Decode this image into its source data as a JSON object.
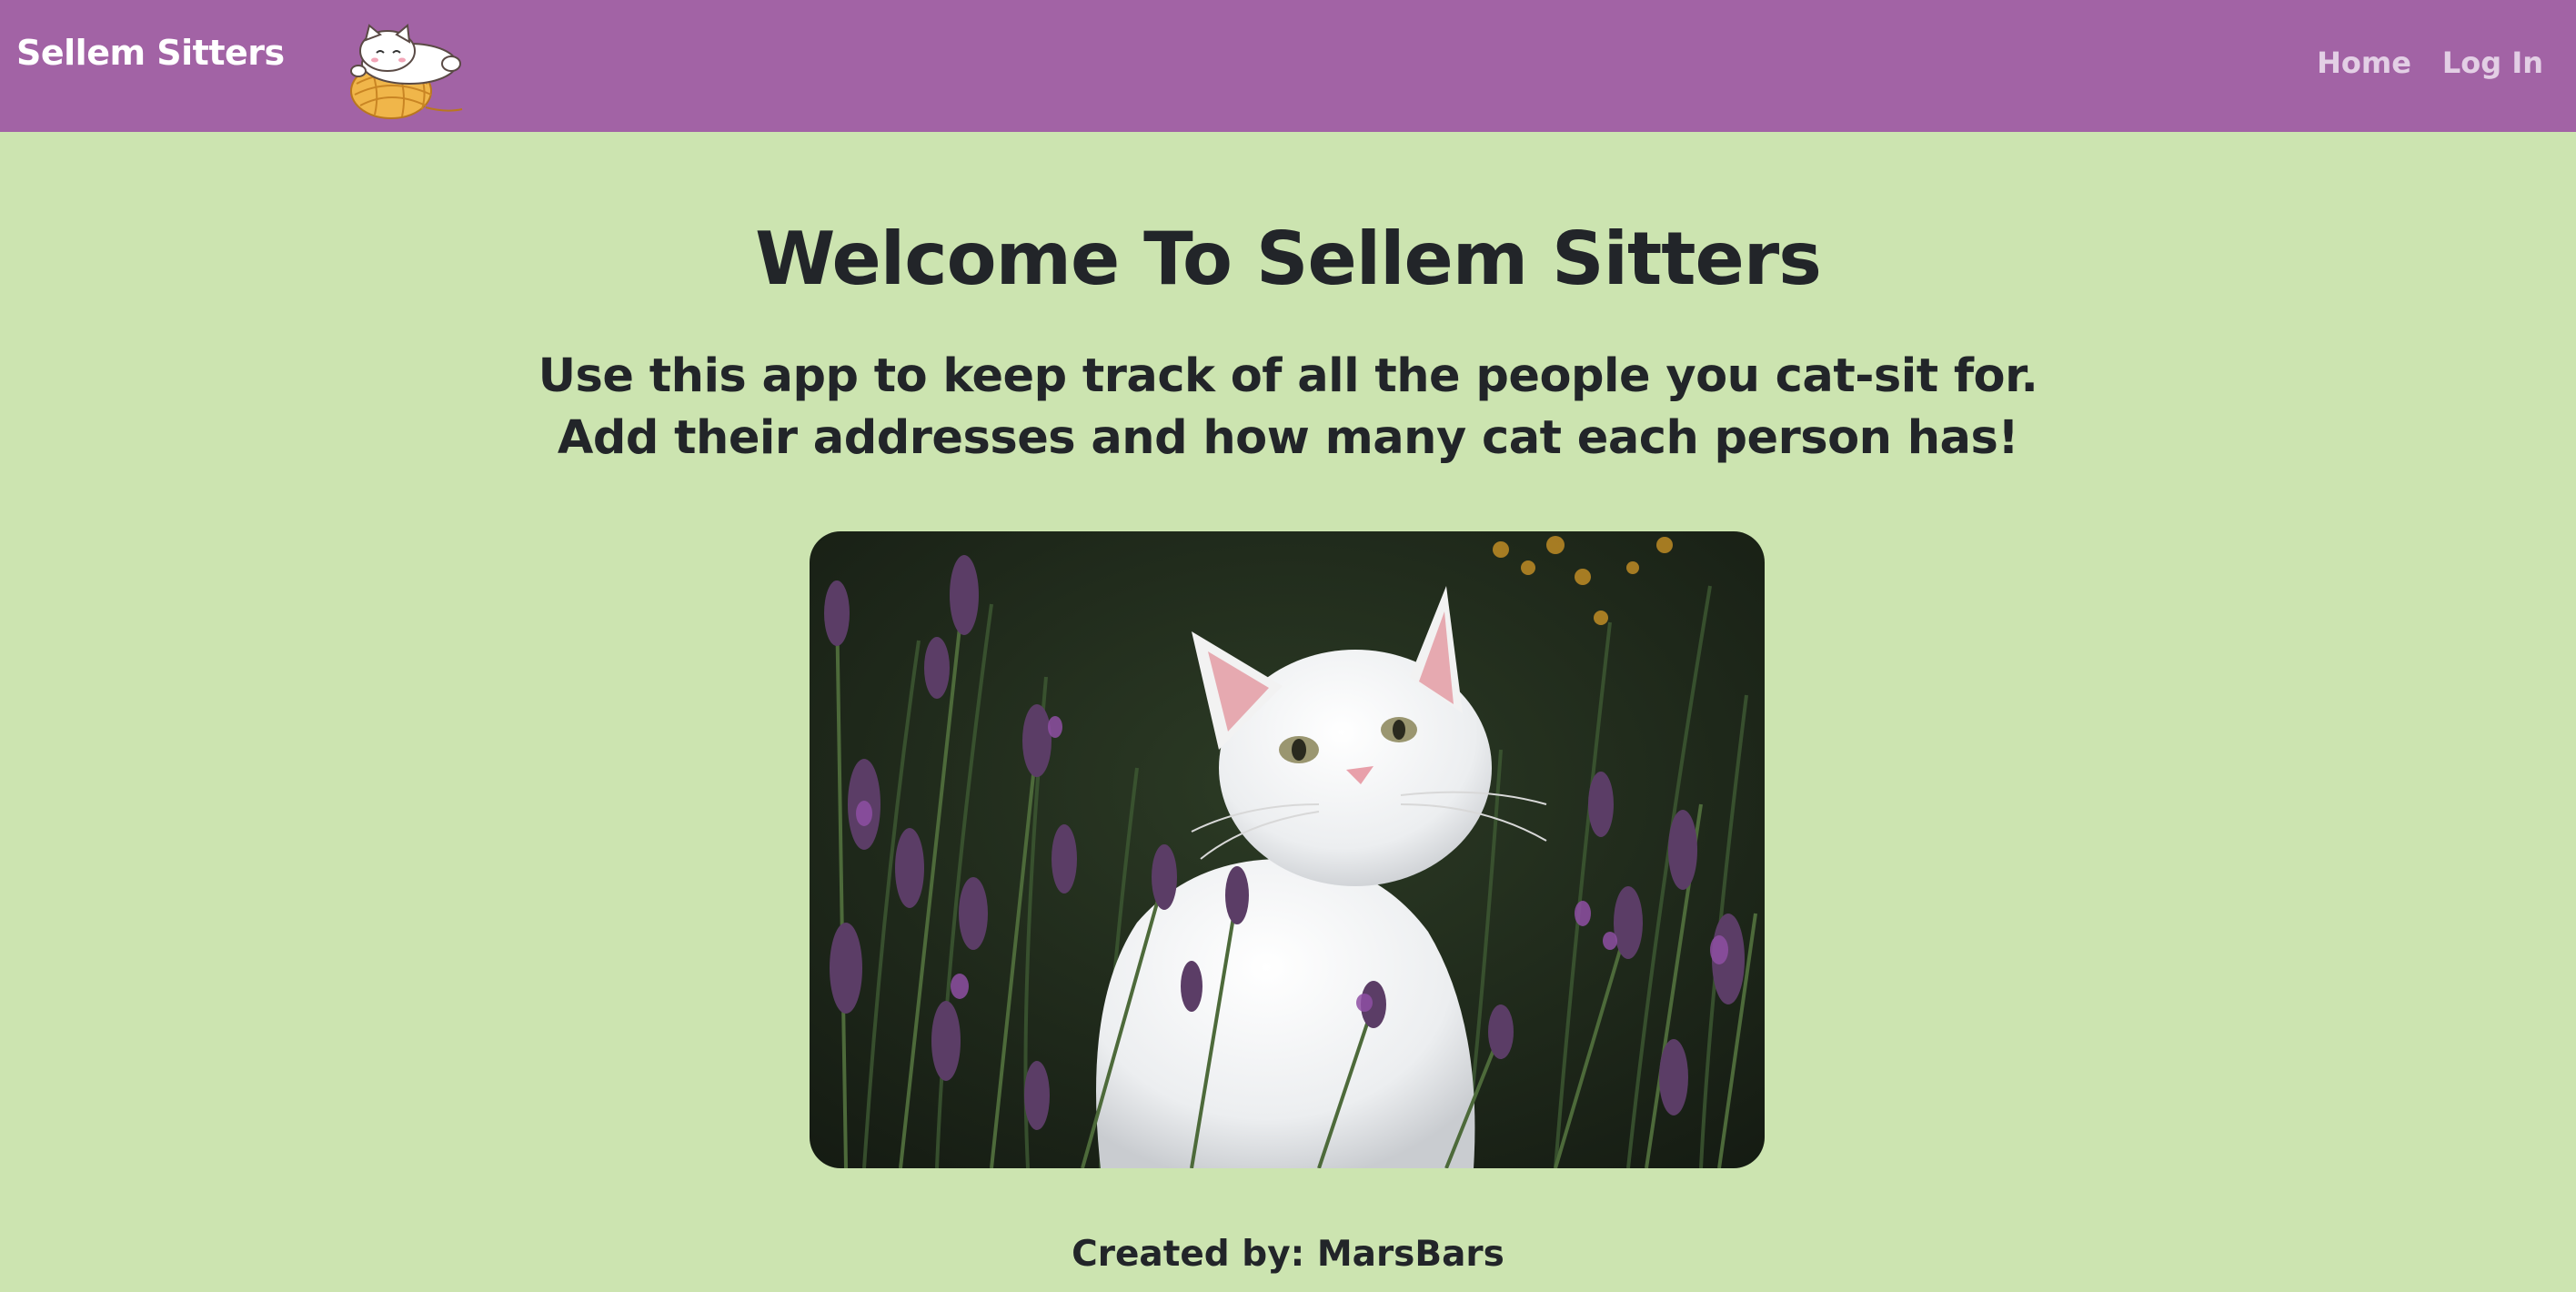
{
  "navbar": {
    "brand": "Sellem Sitters",
    "logo_icon": "cat-on-yarn-ball-icon",
    "links": [
      {
        "label": "Home"
      },
      {
        "label": "Log In"
      }
    ]
  },
  "main": {
    "heading": "Welcome To Sellem Sitters",
    "description_line1": "Use this app to keep track of all the people you cat-sit for.",
    "description_line2": "Add their addresses and how many cat each person has!"
  },
  "footer": {
    "credit": "Created by: MarsBars"
  },
  "colors": {
    "navbar_bg": "#a263a5",
    "page_bg": "#cce4b0",
    "text": "#222529",
    "nav_link": "#e3cfe5"
  }
}
